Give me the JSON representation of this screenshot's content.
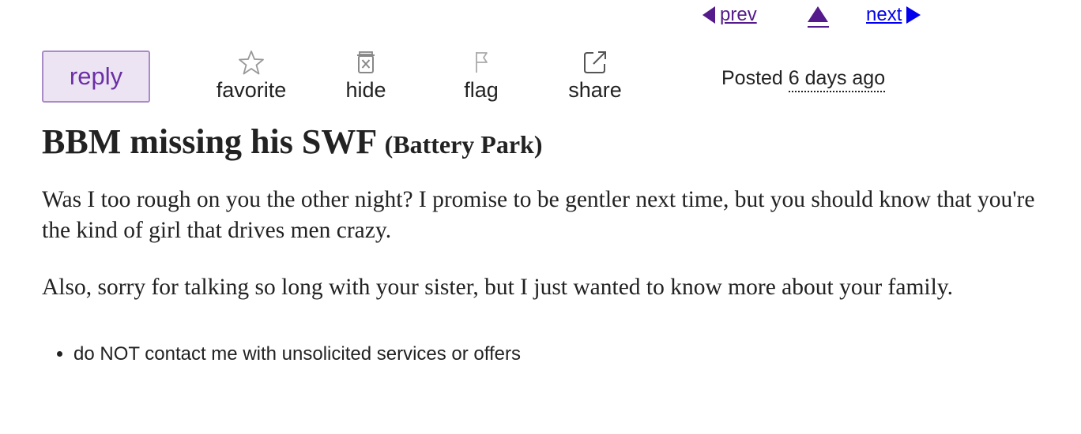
{
  "nav": {
    "prev_label": "prev",
    "next_label": "next",
    "up_icon": "triangle-up-icon",
    "prev_icon": "triangle-left-icon",
    "next_icon": "triangle-right-icon"
  },
  "actions": {
    "reply_label": "reply",
    "favorite_label": "favorite",
    "hide_label": "hide",
    "flag_label": "flag",
    "share_label": "share",
    "favorite_icon": "star-outline-icon",
    "hide_icon": "trash-x-icon",
    "flag_icon": "flag-outline-icon",
    "share_icon": "external-share-icon"
  },
  "posting": {
    "posted_prefix": "Posted",
    "posted_ago": "6 days ago"
  },
  "post": {
    "title": "BBM missing his SWF",
    "location": "(Battery Park)",
    "body": [
      "Was I too rough on you the other night? I promise to be gentler next time, but you should know that you're the kind of girl that drives men crazy.",
      "Also, sorry for talking so long with your sister, but I just wanted to know more about your family."
    ]
  },
  "notices": [
    "do NOT contact me with unsolicited services or offers"
  ],
  "colors": {
    "link_visited": "#551a8b",
    "link_unvisited": "#0000ee",
    "reply_bg": "#ece4f2",
    "reply_border": "#a98bc7",
    "reply_text": "#6b2fa6",
    "icon_gray": "#888888",
    "text": "#222222"
  }
}
